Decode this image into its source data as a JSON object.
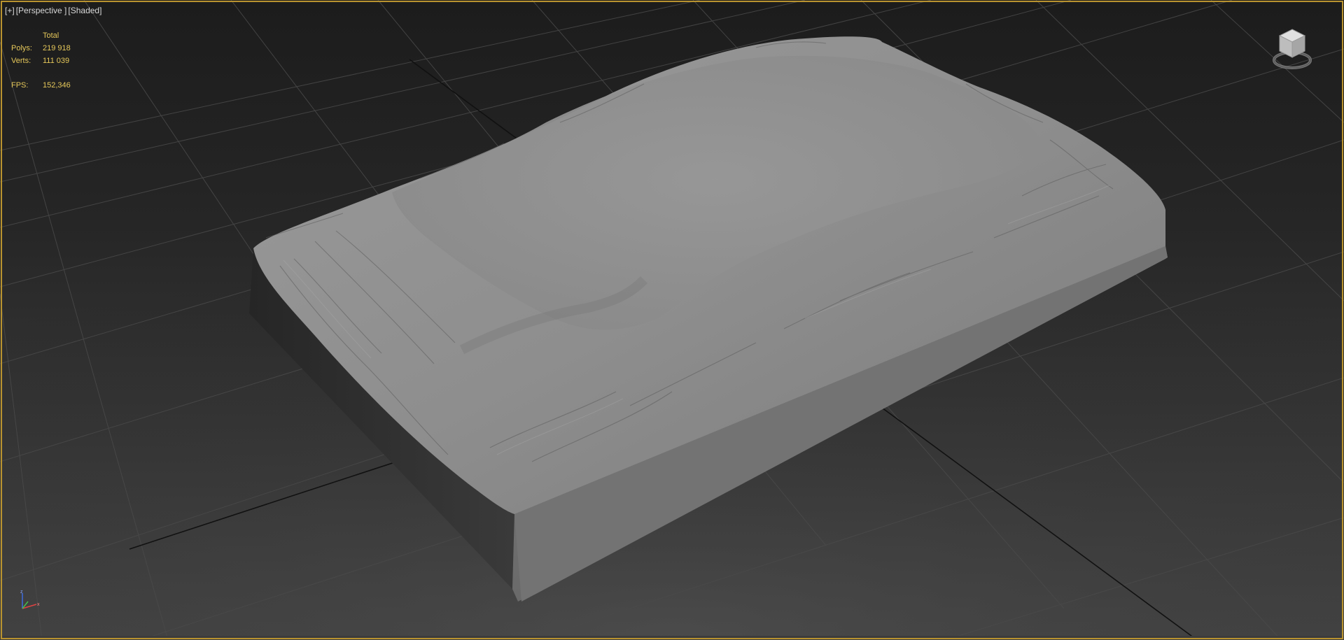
{
  "viewport": {
    "labels": {
      "plus": "[+]",
      "view": "[Perspective ]",
      "shading": "[Shaded]"
    },
    "stats": {
      "header": "Total",
      "polys_label": "Polys:",
      "polys_value": "219 918",
      "verts_label": "Verts:",
      "verts_value": "111 039",
      "fps_label": "FPS:",
      "fps_value": "152,346"
    },
    "viewcube_icon": "viewcube-navigation-icon",
    "axis_icon": "xyz-axis-tripod-icon",
    "colors": {
      "active_border": "#b9932f",
      "stats_text": "#e6c85a",
      "label_text": "#d8d8d8",
      "grid": "#4a4a4a",
      "mesh": "#8a8a8a"
    }
  }
}
